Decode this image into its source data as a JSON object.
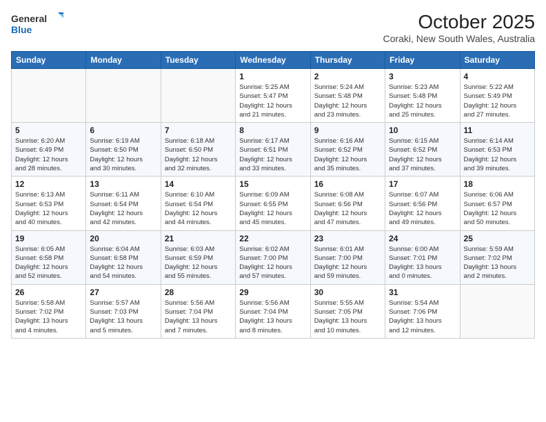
{
  "logo": {
    "line1": "General",
    "line2": "Blue"
  },
  "title": "October 2025",
  "subtitle": "Coraki, New South Wales, Australia",
  "days_of_week": [
    "Sunday",
    "Monday",
    "Tuesday",
    "Wednesday",
    "Thursday",
    "Friday",
    "Saturday"
  ],
  "weeks": [
    [
      {
        "day": "",
        "info": ""
      },
      {
        "day": "",
        "info": ""
      },
      {
        "day": "",
        "info": ""
      },
      {
        "day": "1",
        "info": "Sunrise: 5:25 AM\nSunset: 5:47 PM\nDaylight: 12 hours\nand 21 minutes."
      },
      {
        "day": "2",
        "info": "Sunrise: 5:24 AM\nSunset: 5:48 PM\nDaylight: 12 hours\nand 23 minutes."
      },
      {
        "day": "3",
        "info": "Sunrise: 5:23 AM\nSunset: 5:48 PM\nDaylight: 12 hours\nand 25 minutes."
      },
      {
        "day": "4",
        "info": "Sunrise: 5:22 AM\nSunset: 5:49 PM\nDaylight: 12 hours\nand 27 minutes."
      }
    ],
    [
      {
        "day": "5",
        "info": "Sunrise: 6:20 AM\nSunset: 6:49 PM\nDaylight: 12 hours\nand 28 minutes."
      },
      {
        "day": "6",
        "info": "Sunrise: 6:19 AM\nSunset: 6:50 PM\nDaylight: 12 hours\nand 30 minutes."
      },
      {
        "day": "7",
        "info": "Sunrise: 6:18 AM\nSunset: 6:50 PM\nDaylight: 12 hours\nand 32 minutes."
      },
      {
        "day": "8",
        "info": "Sunrise: 6:17 AM\nSunset: 6:51 PM\nDaylight: 12 hours\nand 33 minutes."
      },
      {
        "day": "9",
        "info": "Sunrise: 6:16 AM\nSunset: 6:52 PM\nDaylight: 12 hours\nand 35 minutes."
      },
      {
        "day": "10",
        "info": "Sunrise: 6:15 AM\nSunset: 6:52 PM\nDaylight: 12 hours\nand 37 minutes."
      },
      {
        "day": "11",
        "info": "Sunrise: 6:14 AM\nSunset: 6:53 PM\nDaylight: 12 hours\nand 39 minutes."
      }
    ],
    [
      {
        "day": "12",
        "info": "Sunrise: 6:13 AM\nSunset: 6:53 PM\nDaylight: 12 hours\nand 40 minutes."
      },
      {
        "day": "13",
        "info": "Sunrise: 6:11 AM\nSunset: 6:54 PM\nDaylight: 12 hours\nand 42 minutes."
      },
      {
        "day": "14",
        "info": "Sunrise: 6:10 AM\nSunset: 6:54 PM\nDaylight: 12 hours\nand 44 minutes."
      },
      {
        "day": "15",
        "info": "Sunrise: 6:09 AM\nSunset: 6:55 PM\nDaylight: 12 hours\nand 45 minutes."
      },
      {
        "day": "16",
        "info": "Sunrise: 6:08 AM\nSunset: 6:56 PM\nDaylight: 12 hours\nand 47 minutes."
      },
      {
        "day": "17",
        "info": "Sunrise: 6:07 AM\nSunset: 6:56 PM\nDaylight: 12 hours\nand 49 minutes."
      },
      {
        "day": "18",
        "info": "Sunrise: 6:06 AM\nSunset: 6:57 PM\nDaylight: 12 hours\nand 50 minutes."
      }
    ],
    [
      {
        "day": "19",
        "info": "Sunrise: 6:05 AM\nSunset: 6:58 PM\nDaylight: 12 hours\nand 52 minutes."
      },
      {
        "day": "20",
        "info": "Sunrise: 6:04 AM\nSunset: 6:58 PM\nDaylight: 12 hours\nand 54 minutes."
      },
      {
        "day": "21",
        "info": "Sunrise: 6:03 AM\nSunset: 6:59 PM\nDaylight: 12 hours\nand 55 minutes."
      },
      {
        "day": "22",
        "info": "Sunrise: 6:02 AM\nSunset: 7:00 PM\nDaylight: 12 hours\nand 57 minutes."
      },
      {
        "day": "23",
        "info": "Sunrise: 6:01 AM\nSunset: 7:00 PM\nDaylight: 12 hours\nand 59 minutes."
      },
      {
        "day": "24",
        "info": "Sunrise: 6:00 AM\nSunset: 7:01 PM\nDaylight: 13 hours\nand 0 minutes."
      },
      {
        "day": "25",
        "info": "Sunrise: 5:59 AM\nSunset: 7:02 PM\nDaylight: 13 hours\nand 2 minutes."
      }
    ],
    [
      {
        "day": "26",
        "info": "Sunrise: 5:58 AM\nSunset: 7:02 PM\nDaylight: 13 hours\nand 4 minutes."
      },
      {
        "day": "27",
        "info": "Sunrise: 5:57 AM\nSunset: 7:03 PM\nDaylight: 13 hours\nand 5 minutes."
      },
      {
        "day": "28",
        "info": "Sunrise: 5:56 AM\nSunset: 7:04 PM\nDaylight: 13 hours\nand 7 minutes."
      },
      {
        "day": "29",
        "info": "Sunrise: 5:56 AM\nSunset: 7:04 PM\nDaylight: 13 hours\nand 8 minutes."
      },
      {
        "day": "30",
        "info": "Sunrise: 5:55 AM\nSunset: 7:05 PM\nDaylight: 13 hours\nand 10 minutes."
      },
      {
        "day": "31",
        "info": "Sunrise: 5:54 AM\nSunset: 7:06 PM\nDaylight: 13 hours\nand 12 minutes."
      },
      {
        "day": "",
        "info": ""
      }
    ]
  ]
}
